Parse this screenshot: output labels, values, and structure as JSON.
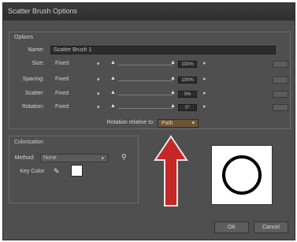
{
  "window": {
    "title": "Scatter Brush Options"
  },
  "options": {
    "label": "Options",
    "name_label": "Name:",
    "name_value": "Scatter Brush 1",
    "rows": [
      {
        "label": "Size:",
        "mode": "Fixed",
        "value": "100%"
      },
      {
        "label": "Spacing:",
        "mode": "Fixed",
        "value": "100%"
      },
      {
        "label": "Scatter:",
        "mode": "Fixed",
        "value": "0%"
      },
      {
        "label": "Rotation:",
        "mode": "Fixed",
        "value": "0°"
      }
    ],
    "rotation_relative_label": "Rotation relative to:",
    "rotation_relative_value": "Path"
  },
  "colorization": {
    "label": "Colorization",
    "method_label": "Method:",
    "method_value": "None",
    "key_color_label": "Key Color:",
    "key_color_swatch": "#ffffff"
  },
  "buttons": {
    "ok": "OK",
    "cancel": "Cancel"
  },
  "icons": {
    "tips": "lightbulb-icon",
    "eyedropper": "eyedropper-icon",
    "arrow": "red-up-arrow",
    "preview": "circle-preview"
  },
  "colors": {
    "dialog_bg": "#4f4f4f",
    "field_bg": "#2c2c2c",
    "accent_dropdown": "#6d5437",
    "arrow": "#c62828"
  }
}
